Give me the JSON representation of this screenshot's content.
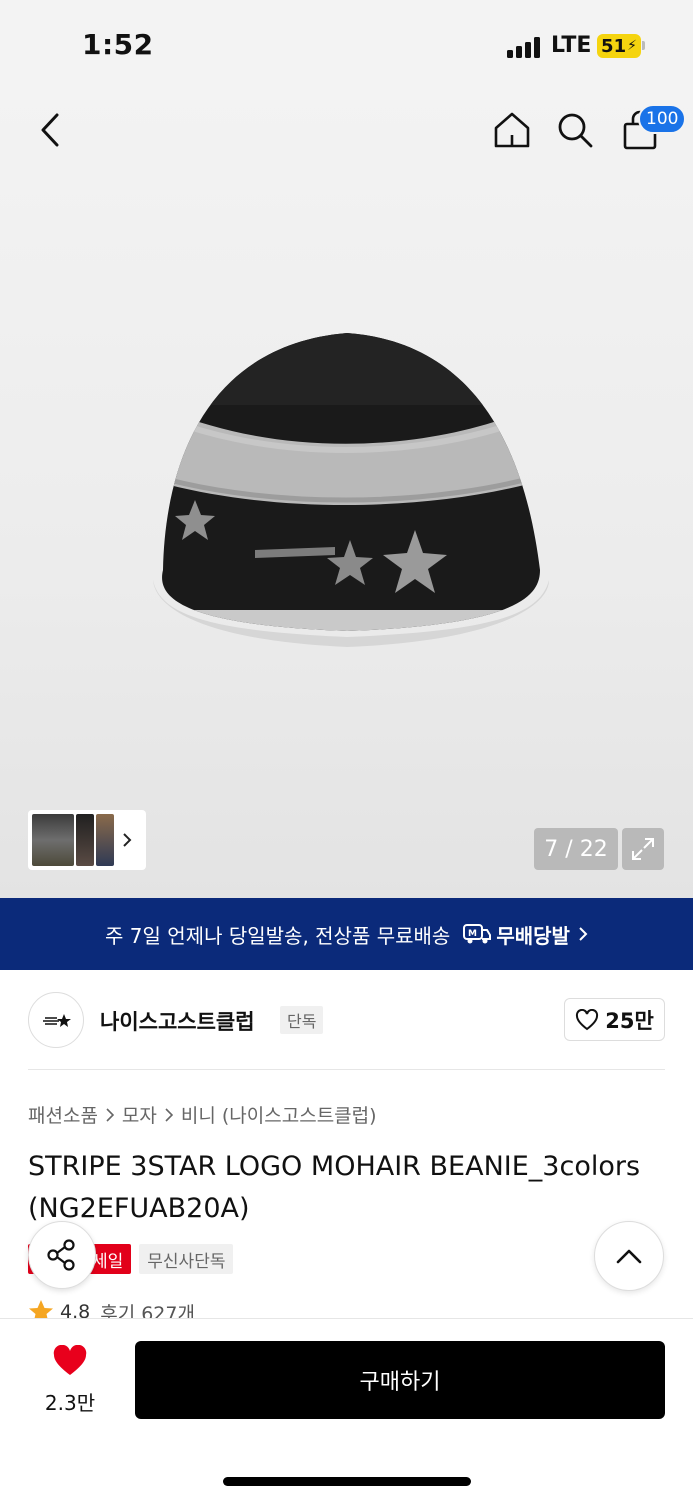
{
  "status_bar": {
    "time": "1:52",
    "network": "LTE",
    "battery": "51"
  },
  "nav": {
    "back_icon": "chevron-left-icon",
    "home_icon": "home-icon",
    "search_icon": "search-icon",
    "cart_icon": "shopping-bag-icon",
    "cart_count": "100"
  },
  "gallery": {
    "counter": "7 / 22",
    "expand_icon": "expand-icon"
  },
  "promo": {
    "text": "주 7일 언제나 당일발송, 전상품 무료배송",
    "brand": "무배당발"
  },
  "brand": {
    "name": "나이스고스트클럽",
    "exclusive_tag": "단독",
    "likes": "25만"
  },
  "breadcrumb": [
    "패션소품",
    "모자",
    "비니 (나이스고스트클럽)"
  ],
  "product": {
    "title": "STRIPE 3STAR LOGO MOHAIR BEANIE_3colors(NG2EFUAB20A)",
    "sale_tag": "세일",
    "exclusive_tag": "무신사단독",
    "rating": "4.8",
    "reviews": "후기 627개"
  },
  "bottom": {
    "wish_count": "2.3만",
    "buy_label": "구매하기"
  },
  "colors": {
    "promo_bg": "#0b2a7a",
    "sale_red": "#e2001a",
    "badge_blue": "#1a73e8",
    "heart_red": "#e8001c"
  }
}
